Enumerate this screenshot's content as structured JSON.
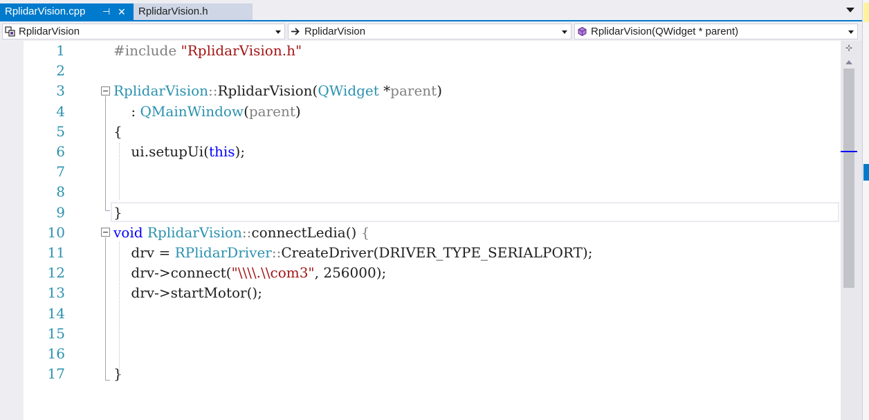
{
  "tabs": [
    {
      "label": "RplidarVision.cpp",
      "active": true,
      "pin_glyph": "⊣",
      "close_glyph": "✕"
    },
    {
      "label": "RplidarVision.h",
      "active": false
    }
  ],
  "navbar": {
    "project_scope": "RplidarVision",
    "class_scope": "RplidarVision",
    "member_scope": "RplidarVision(QWidget * parent)",
    "project_icon": "class-icon",
    "class_icon": "arrow-right-icon",
    "member_icon": "method-cube-icon"
  },
  "editor": {
    "line_numbers": [
      "1",
      "2",
      "3",
      "4",
      "5",
      "6",
      "7",
      "8",
      "9",
      "10",
      "11",
      "12",
      "13",
      "14",
      "15",
      "16",
      "17"
    ],
    "lines": [
      {
        "tokens": [
          {
            "t": "#include ",
            "c": "pp"
          },
          {
            "t": "\"RplidarVision.h\"",
            "c": "st"
          }
        ]
      },
      {
        "tokens": []
      },
      {
        "tokens": [
          {
            "t": "RplidarVision",
            "c": "ty"
          },
          {
            "t": "::",
            "c": "pa"
          },
          {
            "t": "RplidarVision",
            "c": ""
          },
          {
            "t": "(",
            "c": ""
          },
          {
            "t": "QWidget",
            "c": "ty"
          },
          {
            "t": " *",
            "c": ""
          },
          {
            "t": "parent",
            "c": "pa"
          },
          {
            "t": ")",
            "c": ""
          }
        ]
      },
      {
        "tokens": [
          {
            "t": "    : ",
            "c": ""
          },
          {
            "t": "QMainWindow",
            "c": "ty"
          },
          {
            "t": "(",
            "c": ""
          },
          {
            "t": "parent",
            "c": "pa"
          },
          {
            "t": ")",
            "c": ""
          }
        ]
      },
      {
        "tokens": [
          {
            "t": "{",
            "c": ""
          }
        ]
      },
      {
        "tokens": [
          {
            "t": "    ui.setupUi(",
            "c": ""
          },
          {
            "t": "this",
            "c": "kw"
          },
          {
            "t": ");",
            "c": ""
          }
        ]
      },
      {
        "tokens": []
      },
      {
        "tokens": []
      },
      {
        "tokens": [
          {
            "t": "}",
            "c": ""
          }
        ]
      },
      {
        "tokens": [
          {
            "t": "void",
            "c": "kw"
          },
          {
            "t": " ",
            "c": ""
          },
          {
            "t": "RplidarVision",
            "c": "ty"
          },
          {
            "t": "::",
            "c": "pa"
          },
          {
            "t": "connectLedia() ",
            "c": ""
          },
          {
            "t": "{",
            "c": "pa"
          }
        ]
      },
      {
        "tokens": [
          {
            "t": "    drv = ",
            "c": ""
          },
          {
            "t": "RPlidarDriver",
            "c": "ty"
          },
          {
            "t": "::",
            "c": "pa"
          },
          {
            "t": "CreateDriver(DRIVER_TYPE_SERIALPORT);",
            "c": ""
          }
        ]
      },
      {
        "tokens": [
          {
            "t": "    drv->connect(",
            "c": ""
          },
          {
            "t": "\"\\\\\\\\.\\\\com3\"",
            "c": "st"
          },
          {
            "t": ", 256000);",
            "c": ""
          }
        ]
      },
      {
        "tokens": [
          {
            "t": "    drv->startMotor();",
            "c": ""
          }
        ]
      },
      {
        "tokens": []
      },
      {
        "tokens": []
      },
      {
        "tokens": []
      },
      {
        "tokens": [
          {
            "t": "}",
            "c": ""
          }
        ]
      }
    ]
  },
  "scrollbar": {
    "split_glyph": "⊹"
  }
}
